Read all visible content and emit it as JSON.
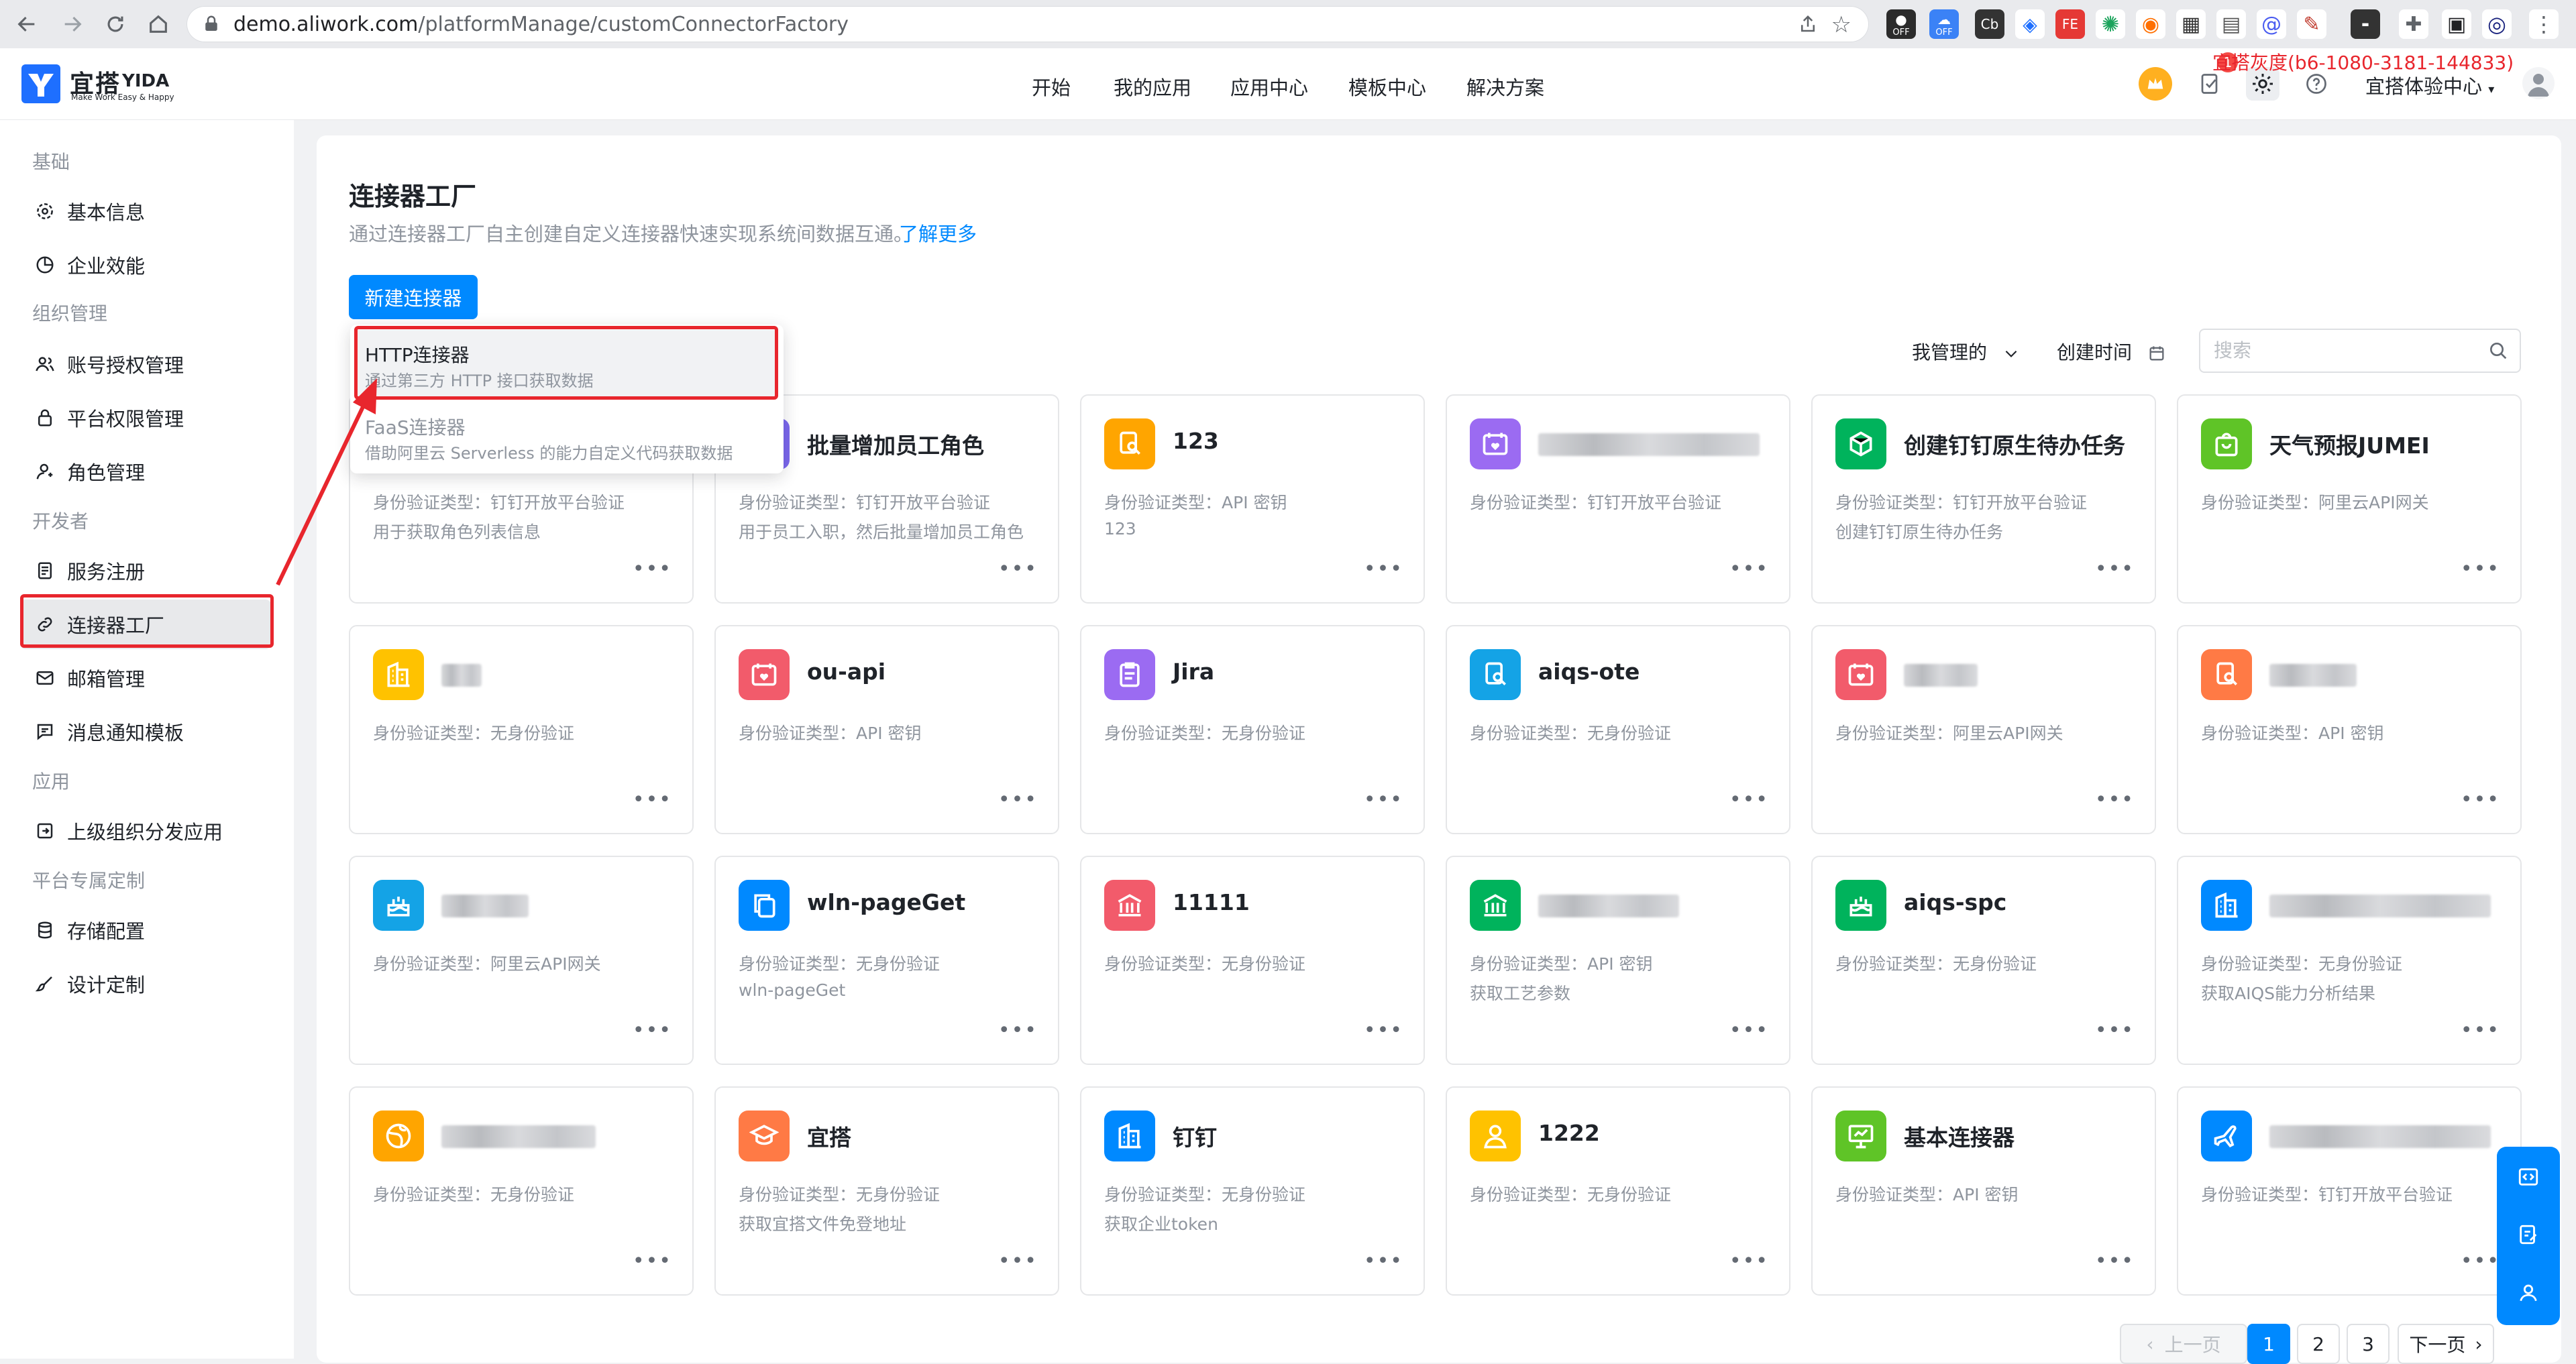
{
  "browser": {
    "url_host": "demo.aliwork.com",
    "url_path": "/platformManage/customConnectorFactory",
    "ext_badges": [
      "OFF",
      "OFF"
    ]
  },
  "header": {
    "logo_text": "宜搭",
    "logo_yida": "YIDA",
    "logo_slogan": "Make Work Easy & Happy",
    "nav": [
      "开始",
      "我的应用",
      "应用中心",
      "模板中心",
      "解决方案"
    ],
    "gray_label": "宜搭灰度(b6-1080-3181-144833)",
    "notify_badge": "1",
    "org_name": "宜搭体验中心"
  },
  "sidebar": {
    "groups": [
      {
        "title": "基础",
        "items": [
          {
            "label": "基本信息",
            "icon": "gear-icon"
          },
          {
            "label": "企业效能",
            "icon": "pie-chart-icon"
          }
        ]
      },
      {
        "title": "组织管理",
        "items": [
          {
            "label": "账号授权管理",
            "icon": "users-icon"
          },
          {
            "label": "平台权限管理",
            "icon": "lock-icon"
          },
          {
            "label": "角色管理",
            "icon": "user-role-icon"
          }
        ]
      },
      {
        "title": "开发者",
        "items": [
          {
            "label": "服务注册",
            "icon": "document-icon"
          },
          {
            "label": "连接器工厂",
            "icon": "link-icon",
            "active": true
          },
          {
            "label": "邮箱管理",
            "icon": "mail-icon"
          },
          {
            "label": "消息通知模板",
            "icon": "message-icon"
          }
        ]
      },
      {
        "title": "应用",
        "items": [
          {
            "label": "上级组织分发应用",
            "icon": "share-out-icon"
          }
        ]
      },
      {
        "title": "平台专属定制",
        "items": [
          {
            "label": "存储配置",
            "icon": "database-icon"
          },
          {
            "label": "设计定制",
            "icon": "brush-icon"
          }
        ]
      }
    ]
  },
  "main": {
    "title": "连接器工厂",
    "desc": "通过连接器工厂自主创建自定义连接器快速实现系统间数据互通。",
    "learn_more": "了解更多",
    "new_button": "新建连接器",
    "dropdown": [
      {
        "title": "HTTP连接器",
        "sub": "通过第三方 HTTP 接口获取数据"
      },
      {
        "title": "FaaS连接器",
        "sub": "借助阿里云 Serverless 的能力自定义代码获取数据"
      }
    ],
    "filter_mine": "我管理的",
    "filter_time": "创建时间",
    "search_placeholder": "搜索",
    "auth_prefix": "身份验证类型：",
    "cards": [
      {
        "name": "",
        "auth": "钉钉开放平台验证",
        "desc": "用于获取角色列表信息",
        "color": "#3370ff",
        "icon": "user-role-icon"
      },
      {
        "name": "批量增加员工角色",
        "auth": "钉钉开放平台验证",
        "desc": "用于员工入职，然后批量增加员工角色",
        "color": "#7b67ee",
        "icon": "users-icon"
      },
      {
        "name": "123",
        "auth": "API 密钥",
        "desc": "123",
        "color": "#ffa500",
        "icon": "search-doc-icon"
      },
      {
        "name": "",
        "auth": "钉钉开放平台验证",
        "desc": "",
        "color": "#9b6bf2",
        "icon": "calendar-heart-icon",
        "blurred": true
      },
      {
        "name": "创建钉钉原生待办任务",
        "auth": "钉钉开放平台验证",
        "desc": "创建钉钉原生待办任务",
        "color": "#00b35c",
        "icon": "cube-icon"
      },
      {
        "name": "天气预报JUMEI",
        "auth": "阿里云API网关",
        "desc": "",
        "color": "#5fc427",
        "icon": "bag-icon"
      },
      {
        "name": "",
        "auth": "无身份验证",
        "desc": "",
        "color": "#ffc200",
        "icon": "building-icon",
        "blurred": true
      },
      {
        "name": "ou-api",
        "auth": "API 密钥",
        "desc": "",
        "color": "#f25b6b",
        "icon": "calendar-heart-icon"
      },
      {
        "name": "Jira",
        "auth": "无身份验证",
        "desc": "",
        "color": "#9b6bf2",
        "icon": "clipboard-icon"
      },
      {
        "name": "aiqs-ote",
        "auth": "无身份验证",
        "desc": "",
        "color": "#14a3e6",
        "icon": "search-doc-icon"
      },
      {
        "name": "",
        "auth": "阿里云API网关",
        "desc": "",
        "color": "#f25b6b",
        "icon": "calendar-heart-icon",
        "blurred": true
      },
      {
        "name": "",
        "auth": "API 密钥",
        "desc": "",
        "color": "#ff7a45",
        "icon": "search-doc-icon",
        "blurred": true
      },
      {
        "name": "",
        "auth": "阿里云API网关",
        "desc": "",
        "color": "#14a3e6",
        "icon": "cake-icon",
        "blurred": true
      },
      {
        "name": "wln-pageGet",
        "auth": "无身份验证",
        "desc": "wln-pageGet",
        "color": "#0089ff",
        "icon": "copy-icon"
      },
      {
        "name": "11111",
        "auth": "无身份验证",
        "desc": "",
        "color": "#f25b6b",
        "icon": "bank-icon"
      },
      {
        "name": "",
        "auth": "API 密钥",
        "desc": "获取工艺参数",
        "color": "#00b35c",
        "icon": "bank-icon",
        "blurred": true
      },
      {
        "name": "aiqs-spc",
        "auth": "无身份验证",
        "desc": "",
        "color": "#00b35c",
        "icon": "cake-icon"
      },
      {
        "name": "",
        "auth": "无身份验证",
        "desc": "获取AIQS能力分析结果",
        "color": "#0089ff",
        "icon": "building-icon",
        "blurred": true
      },
      {
        "name": "",
        "auth": "无身份验证",
        "desc": "",
        "color": "#ffa500",
        "icon": "globe-icon",
        "blurred": true
      },
      {
        "name": "宜搭",
        "auth": "无身份验证",
        "desc": "获取宜搭文件免登地址",
        "color": "#ff7a45",
        "icon": "graduation-icon"
      },
      {
        "name": "钉钉",
        "auth": "无身份验证",
        "desc": "获取企业token",
        "color": "#0089ff",
        "icon": "building-icon"
      },
      {
        "name": "1222",
        "auth": "无身份验证",
        "desc": "",
        "color": "#ffc200",
        "icon": "user-icon"
      },
      {
        "name": "基本连接器",
        "auth": "API 密钥",
        "desc": "",
        "color": "#5fc427",
        "icon": "presentation-icon"
      },
      {
        "name": "",
        "auth": "钉钉开放平台验证",
        "desc": "",
        "color": "#0089ff",
        "icon": "plane-icon",
        "blurred": true
      }
    ],
    "pagination": {
      "prev": "上一页",
      "next": "下一页",
      "pages": [
        "1",
        "2",
        "3"
      ],
      "current": "1"
    }
  }
}
